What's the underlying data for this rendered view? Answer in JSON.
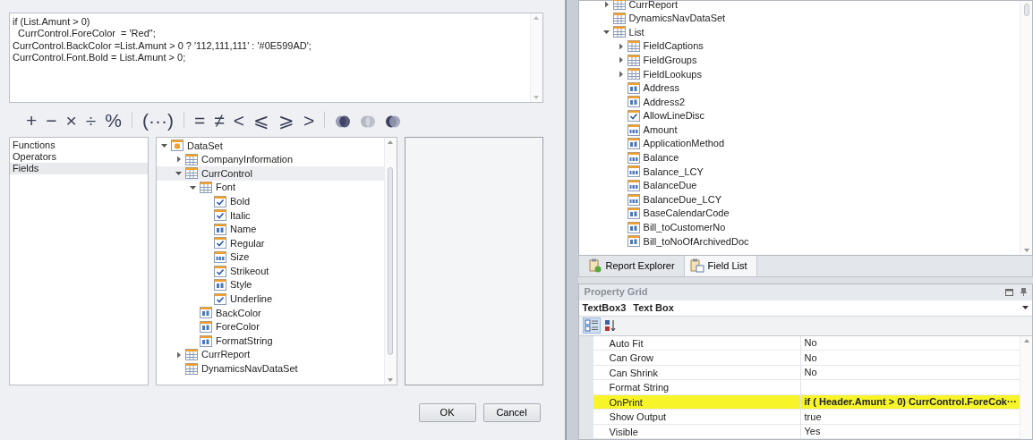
{
  "expression_editor": {
    "code_lines": [
      "if (List.Amunt > 0)",
      "  CurrControl.ForeColor  = 'Red\";",
      "CurrControl.BackColor =List.Amunt > 0 ? '112,111,111' : '#0E599AD';",
      "CurrControl.Font.Bold = List.Amunt > 0;"
    ]
  },
  "operator_groups": [
    [
      {
        "kind": "symbol",
        "label": "+",
        "disabled": false
      },
      {
        "kind": "symbol",
        "label": "−",
        "disabled": false
      },
      {
        "kind": "symbol",
        "label": "×",
        "disabled": false
      },
      {
        "kind": "symbol",
        "label": "÷",
        "disabled": false
      },
      {
        "kind": "symbol",
        "label": "%",
        "disabled": false
      }
    ],
    [
      {
        "kind": "symbol",
        "label": "(···)",
        "disabled": false
      }
    ],
    [
      {
        "kind": "symbol",
        "label": "=",
        "disabled": false
      },
      {
        "kind": "symbol",
        "label": "≠",
        "disabled": false
      },
      {
        "kind": "symbol",
        "label": "<",
        "disabled": false
      },
      {
        "kind": "symbol",
        "label": "⩽",
        "disabled": false
      },
      {
        "kind": "symbol",
        "label": "⩾",
        "disabled": false
      },
      {
        "kind": "symbol",
        "label": ">",
        "disabled": false
      }
    ],
    [
      {
        "kind": "and",
        "disabled": false
      },
      {
        "kind": "or",
        "disabled": true
      },
      {
        "kind": "not",
        "disabled": false
      }
    ]
  ],
  "categories": [
    {
      "label": "Functions",
      "selected": false
    },
    {
      "label": "Operators",
      "selected": false
    },
    {
      "label": "Fields",
      "selected": true
    }
  ],
  "field_tree": [
    {
      "label": "DataSet",
      "kind": "dataset",
      "expanded": true,
      "selected": false,
      "children": [
        {
          "label": "CompanyInformation",
          "kind": "table",
          "expanded": false,
          "selected": false
        },
        {
          "label": "CurrControl",
          "kind": "table",
          "expanded": true,
          "selected": true,
          "children": [
            {
              "label": "Font",
              "kind": "table",
              "expanded": true,
              "selected": false,
              "children": [
                {
                  "label": "Bold",
                  "kind": "bool",
                  "selected": false
                },
                {
                  "label": "Italic",
                  "kind": "bool",
                  "selected": false
                },
                {
                  "label": "Name",
                  "kind": "text",
                  "selected": false
                },
                {
                  "label": "Regular",
                  "kind": "bool",
                  "selected": false
                },
                {
                  "label": "Size",
                  "kind": "number",
                  "selected": false
                },
                {
                  "label": "Strikeout",
                  "kind": "bool",
                  "selected": false
                },
                {
                  "label": "Style",
                  "kind": "text",
                  "selected": false
                },
                {
                  "label": "Underline",
                  "kind": "bool",
                  "selected": false
                }
              ]
            },
            {
              "label": "BackColor",
              "kind": "text",
              "selected": false
            },
            {
              "label": "ForeColor",
              "kind": "text",
              "selected": false
            },
            {
              "label": "FormatString",
              "kind": "text",
              "selected": false
            }
          ]
        },
        {
          "label": "CurrReport",
          "kind": "table",
          "expanded": false,
          "selected": false
        },
        {
          "label": "DynamicsNavDataSet",
          "kind": "table",
          "selected": false
        }
      ]
    }
  ],
  "dialog_buttons": [
    {
      "label": "OK"
    },
    {
      "label": "Cancel"
    }
  ],
  "report_field_tree": [
    {
      "label": "CurrReport",
      "kind": "table",
      "expanded": false,
      "selected": false
    },
    {
      "label": "DynamicsNavDataSet",
      "kind": "table",
      "selected": false
    },
    {
      "label": "List",
      "kind": "table",
      "expanded": true,
      "selected": false,
      "children": [
        {
          "label": "FieldCaptions",
          "kind": "table",
          "expanded": false,
          "selected": false
        },
        {
          "label": "FieldGroups",
          "kind": "table",
          "expanded": false,
          "selected": false
        },
        {
          "label": "FieldLookups",
          "kind": "table",
          "expanded": false,
          "selected": false
        },
        {
          "label": "Address",
          "kind": "text",
          "selected": false
        },
        {
          "label": "Address2",
          "kind": "text",
          "selected": false
        },
        {
          "label": "AllowLineDisc",
          "kind": "bool",
          "selected": false
        },
        {
          "label": "Amount",
          "kind": "number",
          "selected": false
        },
        {
          "label": "ApplicationMethod",
          "kind": "text",
          "selected": false
        },
        {
          "label": "Balance",
          "kind": "number",
          "selected": false
        },
        {
          "label": "Balance_LCY",
          "kind": "number",
          "selected": false
        },
        {
          "label": "BalanceDue",
          "kind": "number",
          "selected": false
        },
        {
          "label": "BalanceDue_LCY",
          "kind": "number",
          "selected": false
        },
        {
          "label": "BaseCalendarCode",
          "kind": "text",
          "selected": false
        },
        {
          "label": "Bill_toCustomerNo",
          "kind": "text",
          "selected": false
        },
        {
          "label": "Bill_toNoOfArchivedDoc",
          "kind": "text",
          "selected": false
        }
      ]
    }
  ],
  "panel_tabs": [
    {
      "label": "Report Explorer",
      "kind": "explorer",
      "selected": false
    },
    {
      "label": "Field List",
      "kind": "fields",
      "selected": true
    }
  ],
  "property_grid": {
    "title": "Property Grid",
    "object_name": "TextBox3",
    "object_type": "Text Box",
    "toolbar": [
      {
        "kind": "categorized",
        "selected": true
      },
      {
        "kind": "alphabetical",
        "selected": false
      }
    ],
    "rows": [
      {
        "name": "Auto Fit",
        "value": "No",
        "modified": false,
        "highlighted": false
      },
      {
        "name": "Can Grow",
        "value": "No",
        "modified": false,
        "highlighted": false
      },
      {
        "name": "Can Shrink",
        "value": "No",
        "modified": false,
        "highlighted": false
      },
      {
        "name": "Format String",
        "modified": false,
        "highlighted": false
      },
      {
        "name": "OnPrint",
        "value": "if ( Header.Amunt > 0)  CurrControl.ForeCok",
        "ellipsis": "···",
        "modified": true,
        "highlighted": true
      },
      {
        "name": "Show Output",
        "value": "true",
        "modified": false,
        "highlighted": false
      },
      {
        "name": "Visible",
        "value": "Yes",
        "modified": false,
        "highlighted": false
      }
    ]
  }
}
